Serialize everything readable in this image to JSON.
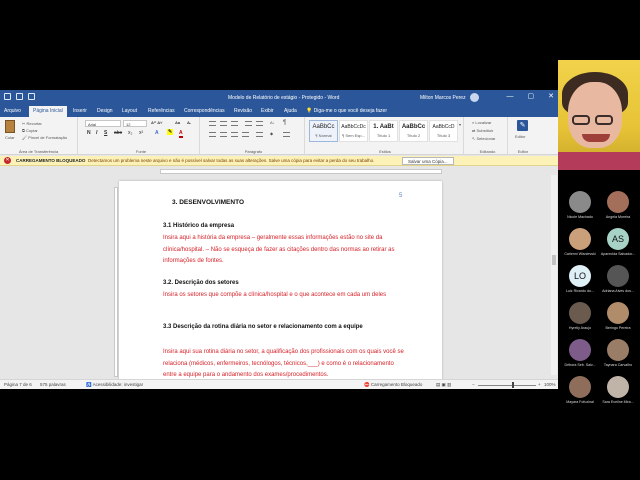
{
  "word": {
    "doc_title": "Modelo de Relatório de estágio - Protegido - Word",
    "user_name": "Milton Marcos Perez",
    "window_buttons": [
      "—",
      "▢",
      "✕"
    ],
    "tabs": [
      "Arquivo",
      "Página Inicial",
      "Inserir",
      "Design",
      "Layout",
      "Referências",
      "Correspondências",
      "Revisão",
      "Exibir",
      "Ajuda"
    ],
    "tell_me": "Diga-me o que você deseja fazer",
    "clipboard": {
      "paste": "Colar",
      "cut": "Recortar",
      "copy": "Copiar",
      "format_painter": "Pincel de Formatação",
      "label": "Área de Transferência"
    },
    "font": {
      "name": "Arial",
      "size": "12",
      "buttons": [
        "N",
        "I",
        "S",
        "abc",
        "x₂",
        "x²",
        "A",
        "A"
      ],
      "label": "Fonte"
    },
    "paragraph_label": "Parágrafo",
    "styles": [
      {
        "sample": "AaBbCc",
        "name": "¶ Normal"
      },
      {
        "sample": "AaBbCcDc",
        "name": "¶ Sem Esp..."
      },
      {
        "sample": "1. AaBt",
        "name": "Título 1"
      },
      {
        "sample": "AaBbCc",
        "name": "Título 2"
      },
      {
        "sample": "AaBbCcD",
        "name": "Título 3"
      }
    ],
    "styles_label": "Estilos",
    "editing": {
      "find": "Localizar",
      "replace": "Substituir",
      "select": "Selecionar",
      "label": "Editando"
    },
    "editor": {
      "label": "Editor",
      "group": "Editor"
    },
    "infobar": {
      "title": "CARREGAMENTO BLOQUEADO",
      "message": "Detectamos um problema neste arquivo e não é possível salvar todas as suas alterações. Salve uma cópia para evitar a perda do seu trabalho.",
      "button": "Salvar uma Cópia..."
    },
    "document": {
      "page_number": "5",
      "heading": "3.   DESENVOLVIMENTO",
      "s31_title": "3.1 Histórico da empresa",
      "s31_text": "Insira aqui a história da empresa – geralmente essas informações estão no site da clínica/hospital. – Não se esqueça de fazer as citações dentro das normas ao retirar as informações de fontes.",
      "s32_title": "3.2. Descrição dos setores",
      "s32_text": "Insira os setores que compõe a clínica/hospital e o que acontece em cada um deles",
      "s33_title": "3.3 Descrição da rotina diária no setor e relacionamento com a equipe",
      "s33_text": "Insira aqui sua rotina diária no setor, a qualificação dos profissionais com os quais você se relaciona (médicos, enfermeiros, tecnólogos, técnicos,___) e como é o relacionamento entre a equipe para o andamento dos exames/procedimentos."
    },
    "status": {
      "page": "Página 7 de 6",
      "words": "575 palavras",
      "accessibility": "Acessibilidade: investigar",
      "load": "Carregamento Bloqueado",
      "zoom": "100%"
    }
  },
  "meeting": {
    "participants": [
      {
        "name": "Nicole Machado",
        "initials": "",
        "color": "#8a8a8a"
      },
      {
        "name": "Angela Moreira",
        "initials": "",
        "color": "#a36f5a"
      },
      {
        "name": "Carlenni Wisnievski",
        "initials": "",
        "color": "#c9a07a"
      },
      {
        "name": "Aparecida Salvador...",
        "initials": "AS",
        "color": "#a7d3c6"
      },
      {
        "name": "Luiz Ricardo do...",
        "initials": "LO",
        "color": "#dff0f7"
      },
      {
        "name": "Adriana Alves dos...",
        "initials": "",
        "color": "#555555"
      },
      {
        "name": "Hyrelly Araujo",
        "initials": "",
        "color": "#6b5a4e"
      },
      {
        "name": "Beringo Pereira",
        "initials": "",
        "color": "#b08c6a"
      },
      {
        "name": "Débora Seb. Salv...",
        "initials": "",
        "color": "#7e5c8a"
      },
      {
        "name": "Taynara Carvalho",
        "initials": "",
        "color": "#9a7d67"
      },
      {
        "name": "Mayara Fofuzinal",
        "initials": "",
        "color": "#8e6d5b"
      },
      {
        "name": "Sara Eveline Mira...",
        "initials": "",
        "color": "#c0b4a8"
      }
    ]
  }
}
